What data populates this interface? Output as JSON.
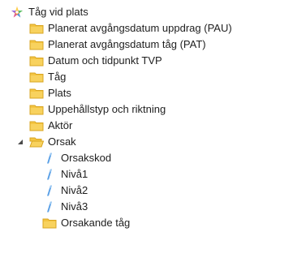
{
  "tree": {
    "root": {
      "label": "Tåg vid plats",
      "icon": "cube-star-icon"
    },
    "items": [
      {
        "label": "Planerat avgångsdatum uppdrag (PAU)",
        "icon": "folder-icon",
        "state": "collapsed"
      },
      {
        "label": "Planerat avgångsdatum tåg (PAT)",
        "icon": "folder-icon",
        "state": "collapsed"
      },
      {
        "label": "Datum och tidpunkt TVP",
        "icon": "folder-icon",
        "state": "collapsed"
      },
      {
        "label": "Tåg",
        "icon": "folder-icon",
        "state": "collapsed"
      },
      {
        "label": "Plats",
        "icon": "folder-icon",
        "state": "collapsed"
      },
      {
        "label": "Uppehållstyp och riktning",
        "icon": "folder-icon",
        "state": "collapsed"
      },
      {
        "label": "Aktör",
        "icon": "folder-icon",
        "state": "collapsed"
      },
      {
        "label": "Orsak",
        "icon": "folder-open-icon",
        "state": "expanded"
      },
      {
        "label": "Orsakskod",
        "icon": "level-icon",
        "state": "leaf"
      },
      {
        "label": "Nivå1",
        "icon": "level-icon",
        "state": "collapsed"
      },
      {
        "label": "Nivå2",
        "icon": "level-icon",
        "state": "collapsed"
      },
      {
        "label": "Nivå3",
        "icon": "level-icon",
        "state": "collapsed"
      },
      {
        "label": "Orsakande tåg",
        "icon": "folder-icon",
        "state": "collapsed"
      }
    ]
  },
  "colors": {
    "folder": "#f4c542",
    "folder_dark": "#d9a520",
    "level": "#5aa0e6",
    "expander": "#9a9a9a",
    "text": "#1e1e1e"
  }
}
